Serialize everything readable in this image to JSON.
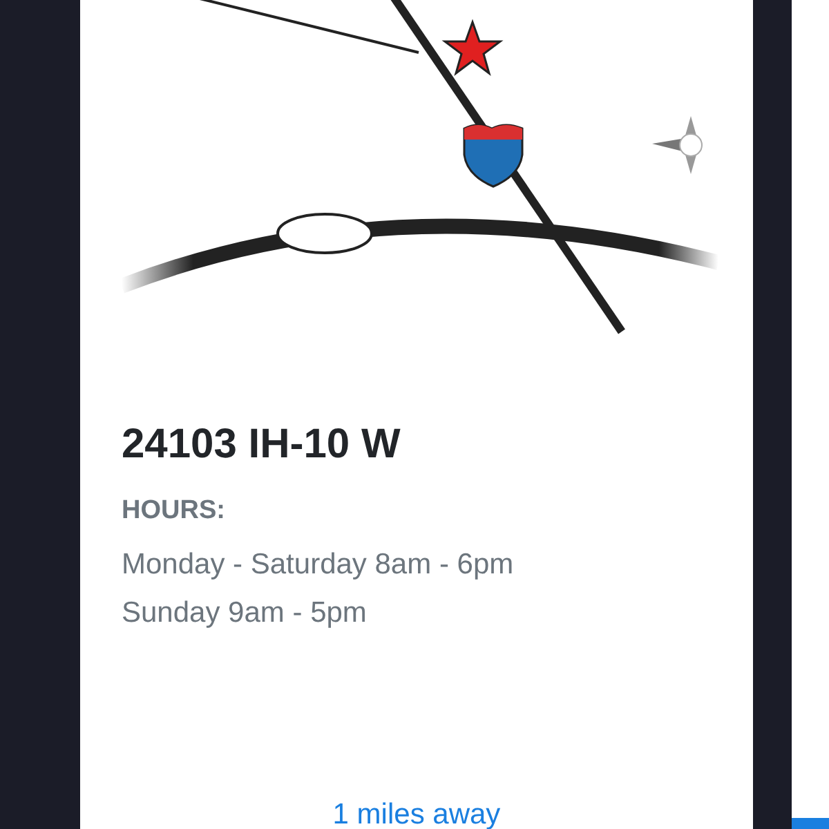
{
  "location_card": {
    "address": "24103 IH-10 W",
    "hours_label": "HOURS:",
    "hours": [
      "Monday - Saturday 8am - 6pm",
      "Sunday 9am - 5pm"
    ],
    "distance_link": "1 miles away"
  }
}
